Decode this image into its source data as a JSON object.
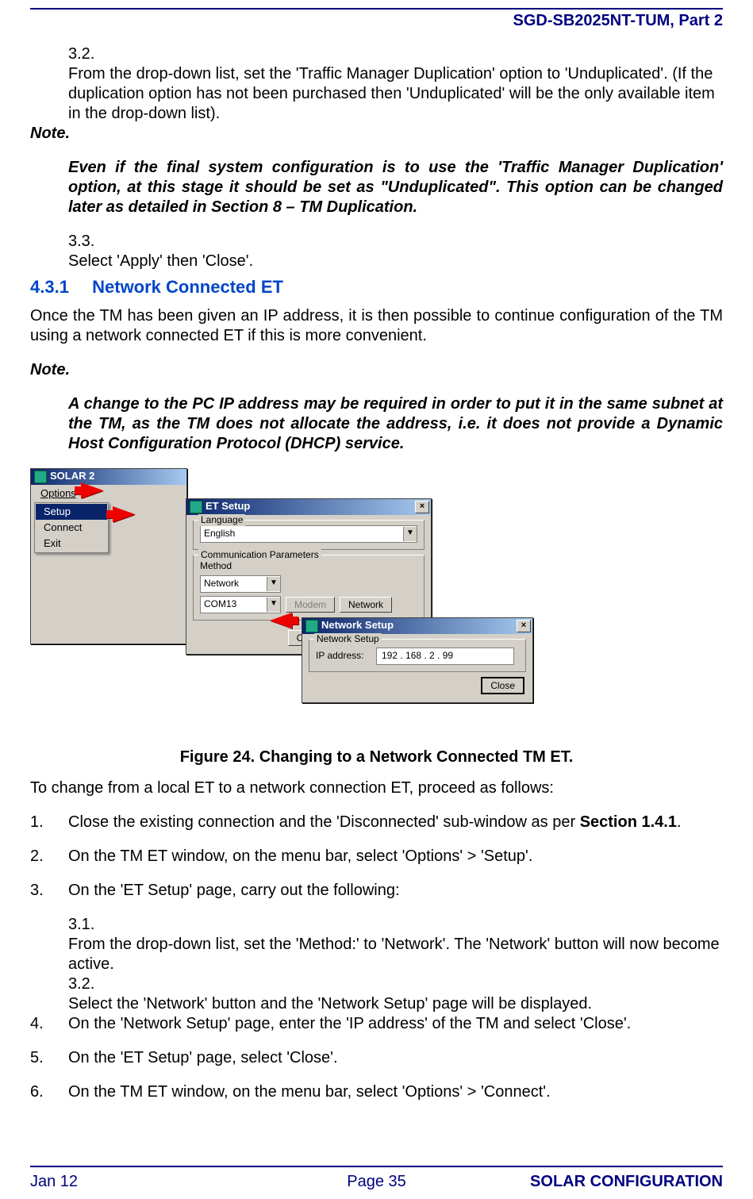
{
  "header": {
    "doc_id": "SGD-SB2025NT-TUM, Part 2"
  },
  "toplist": {
    "item32_num": "3.2.",
    "item32_txt": "From the drop-down list, set the 'Traffic Manager Duplication' option to 'Unduplicated'. (If the duplication option has not been purchased then 'Unduplicated' will be the only available item in the drop-down list).",
    "item33_num": "3.3.",
    "item33_txt": "Select 'Apply' then 'Close'."
  },
  "note1": {
    "head": "Note.",
    "body": "Even if the final system configuration is to use the 'Traffic Manager Duplication' option, at this stage it should be set as \"Unduplicated\".  This option can be changed later as detailed in Section 8 – TM Duplication."
  },
  "sec431": {
    "num": "4.3.1",
    "title": "Network Connected ET",
    "intro": "Once the TM has been given an IP address, it is then possible to continue configuration of the TM using a network connected ET if this is more convenient."
  },
  "note2": {
    "head": "Note.",
    "body": "A change to the PC IP address may be required in order to put it in the same subnet at the TM, as the TM does not allocate the address, i.e. it does not provide a Dynamic Host Configuration Protocol (DHCP) service."
  },
  "figure": {
    "caption": "Figure 24.  Changing to a Network Connected TM ET.",
    "solar_title": "SOLAR 2",
    "menu_options": "Options",
    "menu_setup": "Setup",
    "menu_connect": "Connect",
    "menu_exit": "Exit",
    "et_title": "ET Setup",
    "lang_legend": "Language",
    "lang_value": "English",
    "comm_legend": "Communication Parameters",
    "method_label": "Method",
    "method_value": "Network",
    "com_value": "COM13",
    "btn_modem": "Modem",
    "btn_network": "Network",
    "btn_close": "Close",
    "ns_title": "Network Setup",
    "ns_legend": "Network Setup",
    "ns_label": "IP address:",
    "ns_value": "192 . 168 . 2    .  99",
    "ns_close": "Close"
  },
  "afterfig": {
    "lead": "To change from a local ET to a network connection ET, proceed as follows:",
    "s1n": "1.",
    "s1": "Close the existing connection and the 'Disconnected' sub-window as per ",
    "s1b": "Section 1.4.1",
    "s1c": ".",
    "s2n": "2.",
    "s2": "On the TM ET window, on the menu bar, select 'Options' > 'Setup'.",
    "s3n": "3.",
    "s3": "On the 'ET Setup' page, carry out the following:",
    "s31n": "3.1.",
    "s31": "From the drop-down list, set the 'Method:' to 'Network'.  The 'Network' button will now become active.",
    "s32n": "3.2.",
    "s32": "Select the 'Network' button and the 'Network Setup' page will be displayed.",
    "s4n": "4.",
    "s4": "On the 'Network Setup' page, enter the 'IP address' of the TM and select 'Close'.",
    "s5n": "5.",
    "s5": "On the 'ET Setup' page, select 'Close'.",
    "s6n": "6.",
    "s6": "On the TM ET window, on the menu bar, select 'Options' > 'Connect'."
  },
  "footer": {
    "left": "Jan 12",
    "mid": "Page 35",
    "right": "SOLAR CONFIGURATION"
  }
}
